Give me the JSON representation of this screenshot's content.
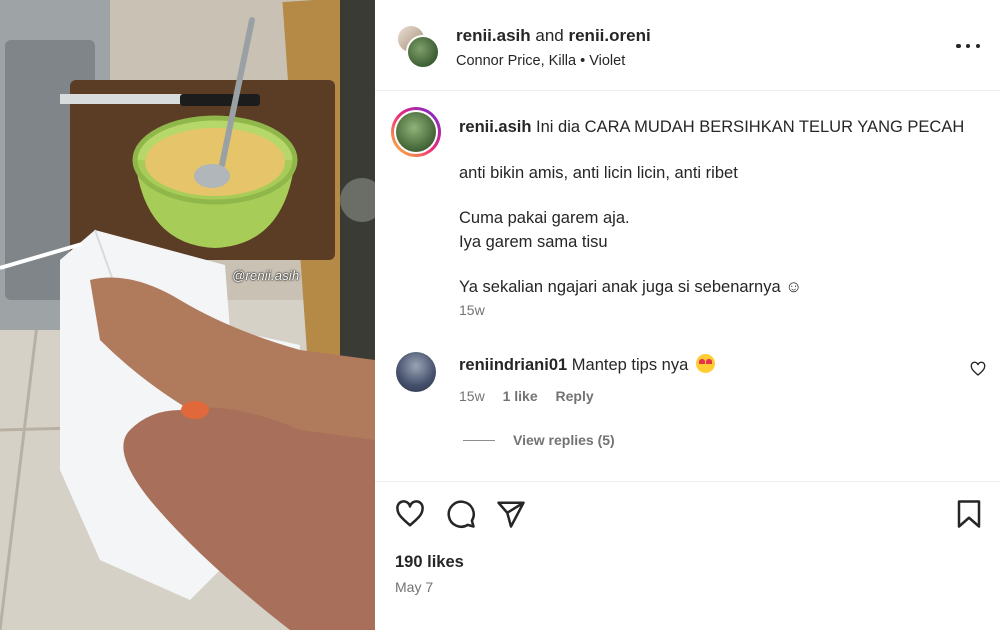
{
  "media": {
    "watermark": "@renii.asih"
  },
  "header": {
    "user1": "renii.asih",
    "connector": "and",
    "user2": "renii.oreni",
    "audio": "Connor Price, Killa",
    "separator": "•",
    "track": "Violet"
  },
  "caption": {
    "username": "renii.asih",
    "lines": [
      "Ini dia CARA MUDAH BERSIHKAN TELUR YANG PECAH",
      "anti bikin amis, anti licin licin, anti ribet",
      "Cuma pakai garem aja.",
      "Iya garem sama tisu",
      "Ya sekalian ngajari anak juga si sebenarnya ☺"
    ],
    "time": "15w"
  },
  "comment": {
    "username": "reniindriani01",
    "text": "Mantep tips nya",
    "emoji": "smiling-face-with-heart-eyes",
    "time": "15w",
    "likes": "1 like",
    "reply": "Reply",
    "view_replies": "View replies (5)"
  },
  "footer": {
    "likes": "190 likes",
    "date": "May 7"
  },
  "icons": [
    "more-icon",
    "heart-icon",
    "comment-icon",
    "share-icon",
    "bookmark-icon"
  ]
}
